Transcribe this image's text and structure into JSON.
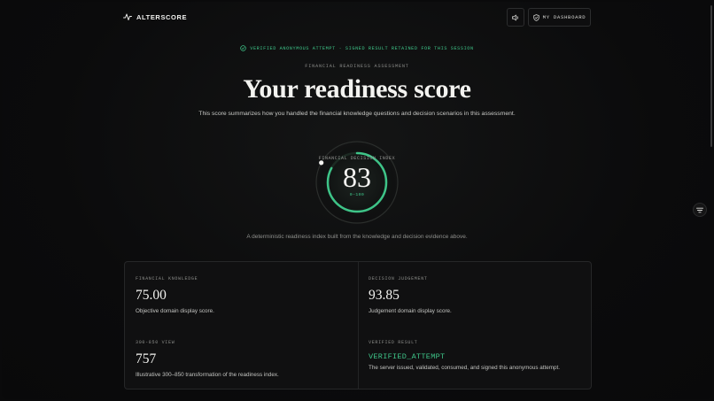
{
  "header": {
    "logo_text": "ALTERSCORE",
    "dashboard_label": "MY DASHBOARD"
  },
  "hero": {
    "verified_banner": "VERIFIED ANONYMOUS ATTEMPT · SIGNED RESULT RETAINED FOR THIS SESSION",
    "eyebrow": "FINANCIAL READINESS ASSESSMENT",
    "title": "Your readiness score",
    "subtitle": "This score summarizes how you handled the financial knowledge questions and decision scenarios in this assessment."
  },
  "gauge": {
    "label": "FINANCIAL DECISION INDEX",
    "value": "83",
    "range": "0–100",
    "fraction": 0.83
  },
  "caption": "A deterministic readiness index built from the knowledge and decision evidence above.",
  "cards": [
    {
      "label": "FINANCIAL KNOWLEDGE",
      "value": "75.00",
      "desc": "Objective domain display score."
    },
    {
      "label": "DECISION JUDGEMENT",
      "value": "93.85",
      "desc": "Judgement domain display score."
    },
    {
      "label": "300-850 VIEW",
      "value": "757",
      "desc": "Illustrative 300–850 transformation of the readiness index."
    },
    {
      "label": "VERIFIED RESULT",
      "value": "VERIFIED_ATTEMPT",
      "desc": "The server issued, validated, consumed, and signed this anonymous attempt."
    }
  ],
  "colors": {
    "accent": "#3ec488",
    "background": "#0a0a0b"
  },
  "icons": {
    "logo": "pulse-icon",
    "sound": "speaker-icon",
    "dashboard": "shield-icon",
    "verified": "check-circle-icon",
    "side": "filter-icon"
  }
}
